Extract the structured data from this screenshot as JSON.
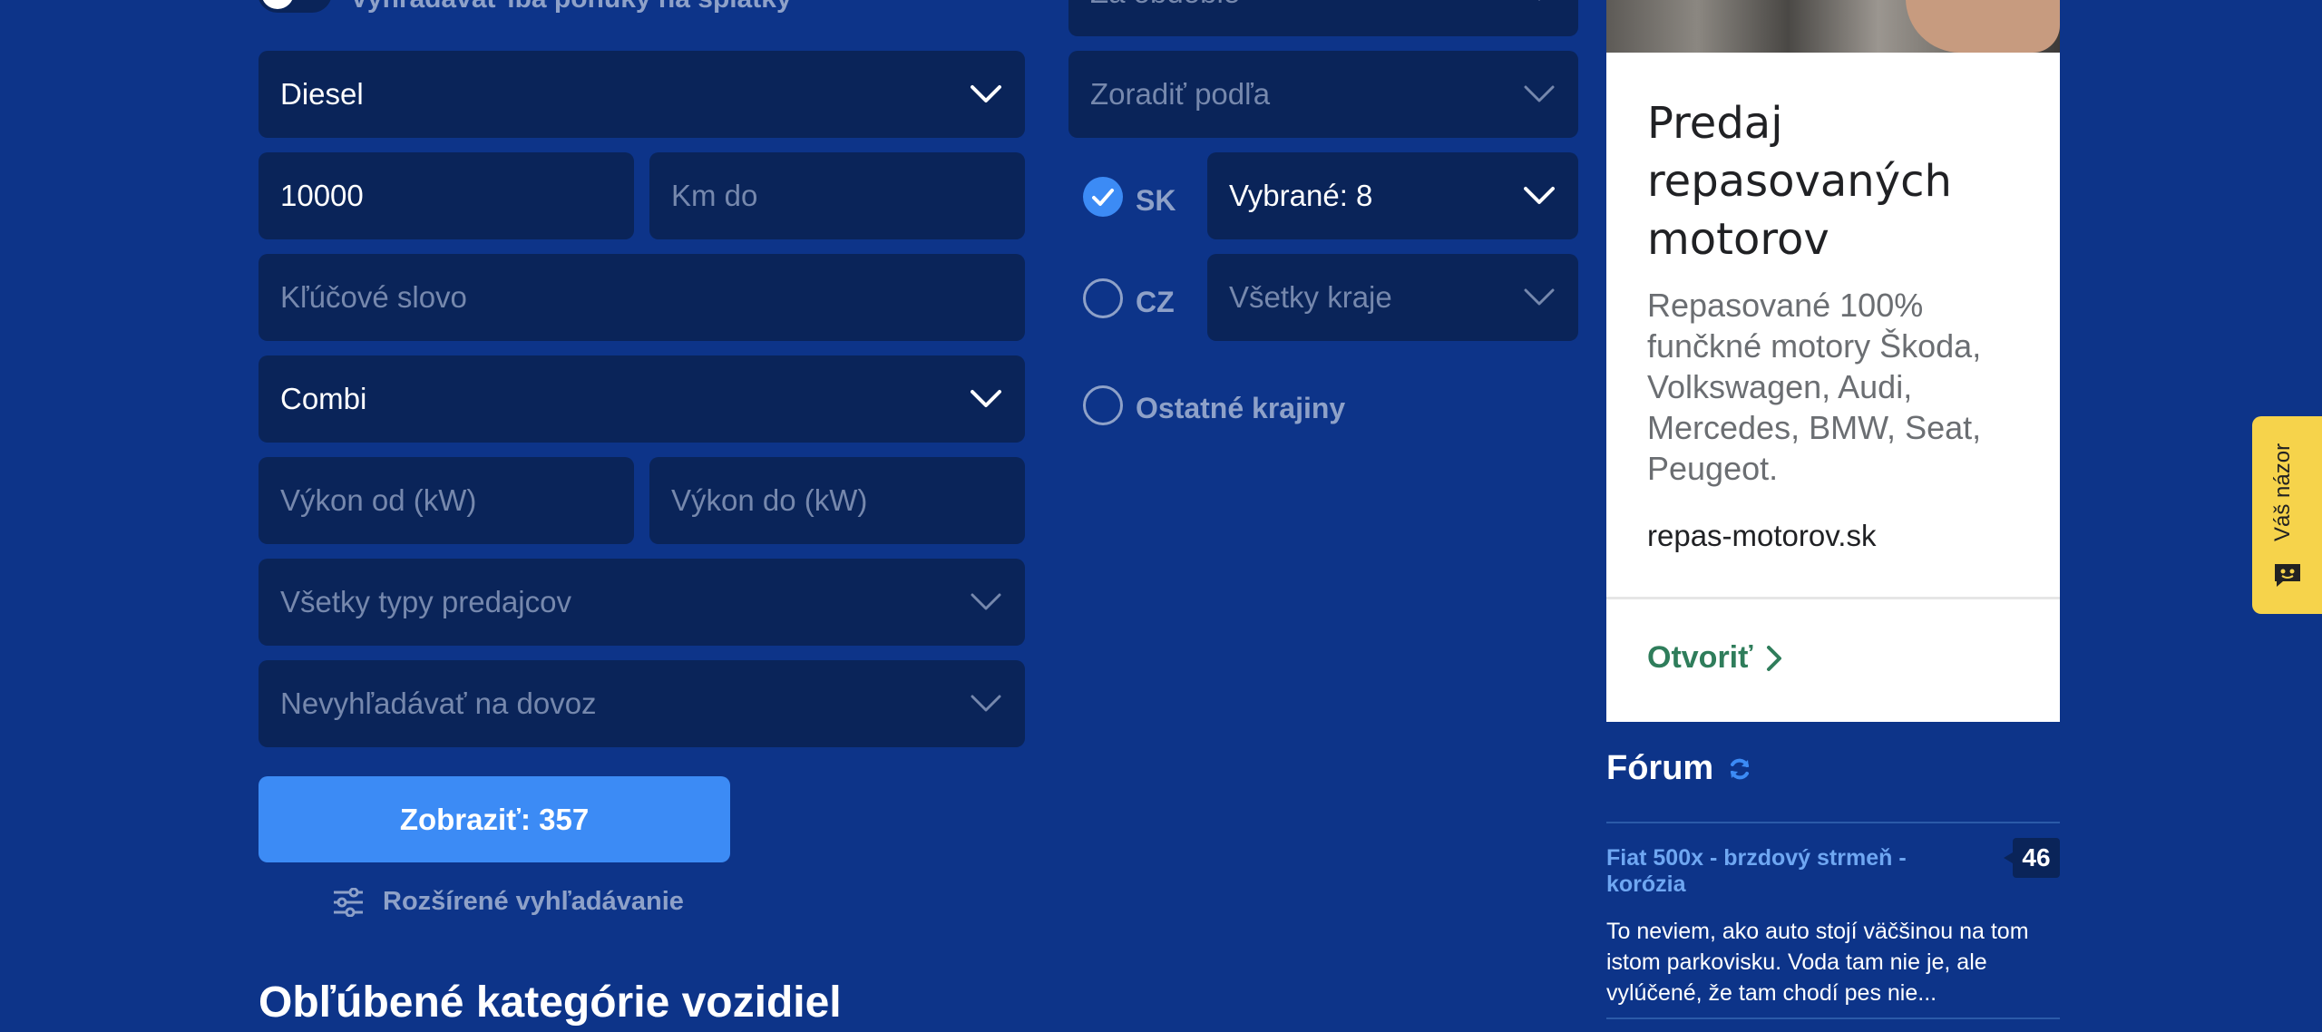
{
  "search_form": {
    "installments_toggle_label": "Vyhľadávať iba ponuky na splátky",
    "fuel": "Diesel",
    "km_from": "10000",
    "km_to_placeholder": "Km do",
    "keyword_placeholder": "Kľúčové slovo",
    "body_type": "Combi",
    "power_from_placeholder": "Výkon od (kW)",
    "power_to_placeholder": "Výkon do (kW)",
    "seller_type": "Všetky typy predajcov",
    "import": "Nevyhľadávať na dovoz",
    "period": "Za obdobie",
    "sort_by": "Zoradiť podľa",
    "country_sk": "SK",
    "sk_regions": "Vybrané: 8",
    "country_cz": "CZ",
    "cz_regions": "Všetky kraje",
    "other_countries": "Ostatné krajiny",
    "submit_label": "Zobraziť: 357",
    "advanced_label": "Rozšírené vyhľadávanie"
  },
  "categories_title": "Obľúbené kategórie vozidiel",
  "ad": {
    "title": "Predaj repasovaných motorov",
    "description": "Repasované 100% funčkné motory Škoda, Volkswagen, Audi, Mercedes, BMW, Seat, Peugeot.",
    "domain": "repas-motorov.sk",
    "cta": "Otvoriť"
  },
  "forum": {
    "title": "Fórum",
    "topic": "Fiat 500x - brzdový strmeň - korózia",
    "count": "46",
    "snippet": "To neviem, ako auto stojí väčšinou na tom istom parkovisku. Voda tam nie je, ale vylúčené, že tam chodí pes nie..."
  },
  "feedback_label": "Váš názor",
  "colors": {
    "background": "#0d3489",
    "field": "#0a2459",
    "accent": "#3c8bf5",
    "feedback": "#f6d34b"
  }
}
